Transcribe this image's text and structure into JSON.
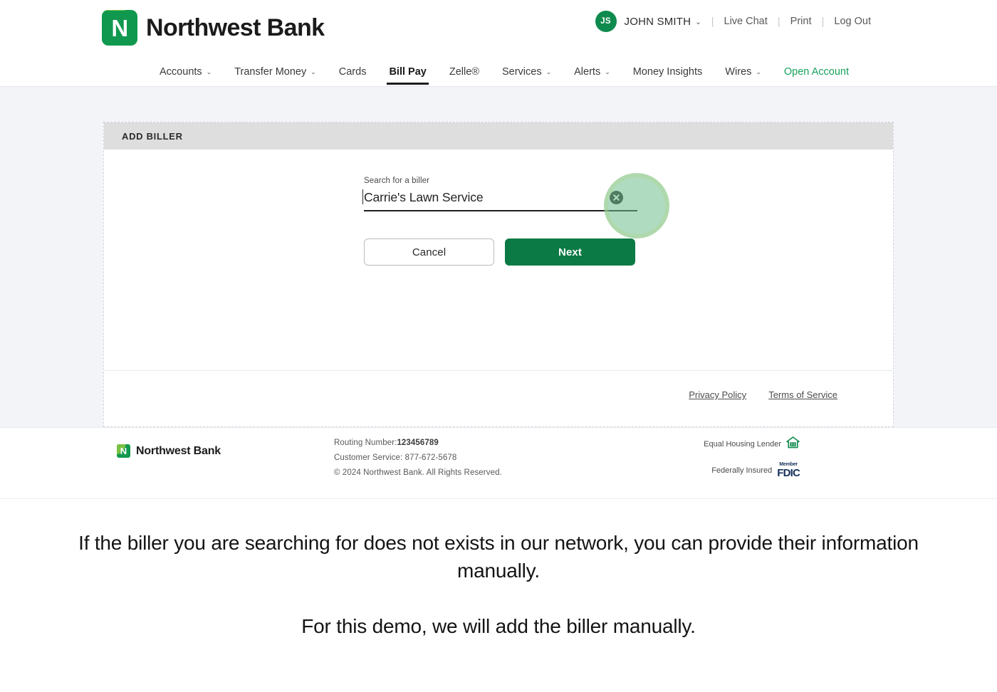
{
  "header": {
    "brand_name": "Northwest Bank",
    "logo_letter": "N",
    "avatar_initials": "JS",
    "user_name": "JOHN SMITH",
    "user_caret": "⌄",
    "links": [
      {
        "label": "Live Chat"
      },
      {
        "label": "Print"
      },
      {
        "label": "Log Out"
      }
    ],
    "divider": "|"
  },
  "nav": {
    "items": [
      {
        "label": "Accounts",
        "caret": "⌄",
        "active": false,
        "accent": false
      },
      {
        "label": "Transfer Money",
        "caret": "⌄",
        "active": false,
        "accent": false
      },
      {
        "label": "Cards",
        "caret": "",
        "active": false,
        "accent": false
      },
      {
        "label": "Bill Pay",
        "caret": "",
        "active": true,
        "accent": false
      },
      {
        "label": "Zelle®",
        "caret": "",
        "active": false,
        "accent": false
      },
      {
        "label": "Services",
        "caret": "⌄",
        "active": false,
        "accent": false
      },
      {
        "label": "Alerts",
        "caret": "⌄",
        "active": false,
        "accent": false
      },
      {
        "label": "Money Insights",
        "caret": "",
        "active": false,
        "accent": false
      },
      {
        "label": "Wires",
        "caret": "⌄",
        "active": false,
        "accent": false
      },
      {
        "label": "Open Account",
        "caret": "",
        "active": false,
        "accent": true
      }
    ]
  },
  "card": {
    "title": "ADD BILLER",
    "search": {
      "label": "Search for a biller",
      "value": "Carrie's Lawn Service",
      "placeholder": "Search for a biller",
      "clear_icon": "clear-x-icon"
    },
    "buttons": {
      "cancel": "Cancel",
      "next": "Next"
    },
    "footer_links": [
      {
        "label": "Privacy Policy"
      },
      {
        "label": "Terms of Service"
      }
    ]
  },
  "site_footer": {
    "brand_name": "Northwest Bank",
    "logo_letter": "N",
    "routing_label": "Routing Number:",
    "routing_value": "123456789",
    "customer_service": "Customer Service: 877-672-5678",
    "copyright": "© 2024 Northwest Bank. All Rights Reserved.",
    "equal_housing_label": "Equal Housing Lender",
    "federally_insured_label": "Federally Insured",
    "fdic_member": "Member",
    "fdic_main": "FDIC"
  },
  "caption": {
    "line1": "If the biller you are searching for does not exists in our network, you can provide their information manually.",
    "line2": "For this demo, we will add the biller manually."
  },
  "colors": {
    "brand_green": "#10994e",
    "accent_green": "#17a05a",
    "button_green": "#0b7a44",
    "light_green": "#7ac143",
    "page_bg": "#f2f4f8",
    "card_head_bg": "#dedede",
    "fdic_navy": "#16305c"
  }
}
